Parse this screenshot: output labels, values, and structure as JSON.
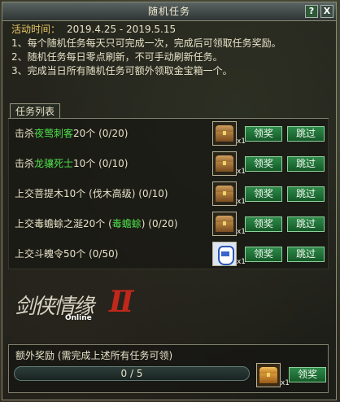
{
  "window": {
    "title": "随机任务",
    "help_label": "?",
    "close_label": "X"
  },
  "description": {
    "period_label": "活动时间：",
    "period_value": "2019.4.25 - 2019.5.15",
    "rules": [
      "1、每个随机任务每天只可完成一次，完成后可领取任务奖励。",
      "2、随机任务每日零点刷新，不可手动刷新任务。",
      "3、完成当日所有随机任务可额外领取金宝箱一个。"
    ]
  },
  "tab": {
    "label": "任务列表"
  },
  "tasks": [
    {
      "prefix": "击杀",
      "highlight": "夜莺刺客",
      "suffix": "20个 (0/20)",
      "icon": "treasure-chest-icon",
      "qty": "x1",
      "claim": "领奖",
      "skip": "跳过"
    },
    {
      "prefix": "击杀",
      "highlight": "龙骧死士",
      "suffix": "10个 (0/10)",
      "icon": "treasure-chest-icon",
      "qty": "x1",
      "claim": "领奖",
      "skip": "跳过"
    },
    {
      "prefix": "上交菩提木10个 (伐木高级) (0/10)",
      "highlight": "",
      "suffix": "",
      "icon": "treasure-chest-icon",
      "qty": "x1",
      "claim": "领奖",
      "skip": "跳过"
    },
    {
      "prefix": "上交毒蟾蜍之涎20个 (",
      "highlight": "毒蟾蜍",
      "suffix": ") (0/20)",
      "icon": "treasure-chest-icon",
      "qty": "x1",
      "claim": "领奖",
      "skip": "跳过"
    },
    {
      "prefix": "上交斗魄令50个 (0/50)",
      "highlight": "",
      "suffix": "",
      "icon": "porcelain-vase-icon",
      "qty": "x1",
      "claim": "领奖",
      "skip": "跳过"
    }
  ],
  "logo": {
    "name": "剑侠情缘",
    "numeral": "Ⅱ",
    "sub": "Online"
  },
  "bonus": {
    "title": "额外奖励 (需完成上述所有任务可领)",
    "progress_text": "0 / 5",
    "progress_fraction": 0,
    "icon": "gold-treasure-chest-icon",
    "qty": "x1",
    "claim": "领奖"
  }
}
